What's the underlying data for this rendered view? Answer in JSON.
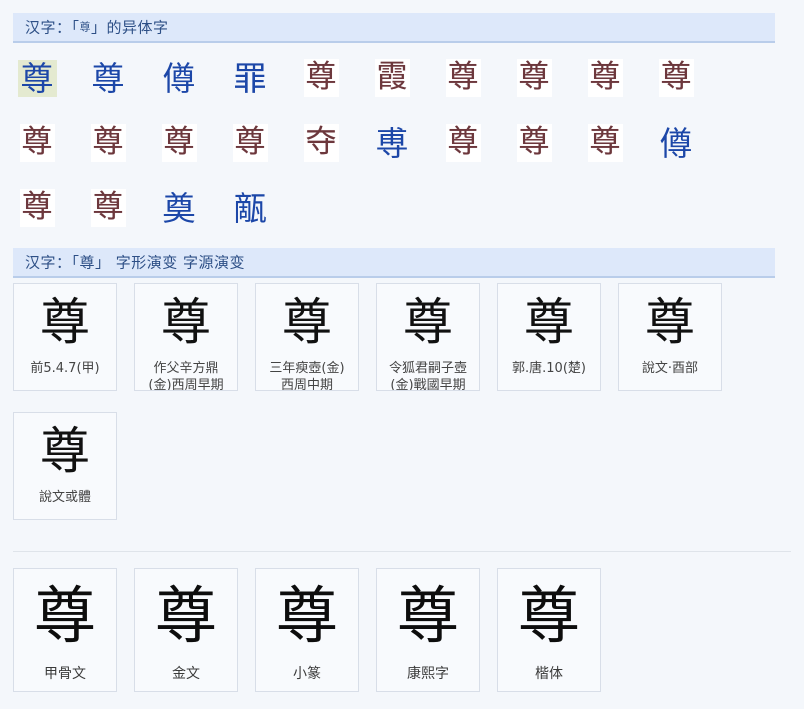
{
  "page": {
    "background_color": "#f4f7fb",
    "band_color": "#dde8fa",
    "band_border_color": "#b9cdea",
    "band_text_color": "#2d4f86",
    "selected_highlight_color": "#e4ead0",
    "variant_text_color": "#1c47a8",
    "variant_scan_color": "#6d3a3f"
  },
  "sections": {
    "variants": {
      "header_prefix": "汉字：「",
      "header_char": "尊",
      "header_suffix": "」的异体字",
      "header_full": "汉字：「尊」的异体字",
      "rows": [
        [
          {
            "glyph": "尊",
            "kind": "text",
            "selected": true
          },
          {
            "glyph": "尊",
            "kind": "text",
            "selected": false
          },
          {
            "glyph": "僔",
            "kind": "text",
            "selected": false
          },
          {
            "glyph": "罪",
            "kind": "text",
            "selected": false
          },
          {
            "glyph": "尊",
            "kind": "scan",
            "selected": false
          },
          {
            "glyph": "霞",
            "kind": "scan",
            "selected": false
          },
          {
            "glyph": "尊",
            "kind": "scan",
            "selected": false
          },
          {
            "glyph": "尊",
            "kind": "scan",
            "selected": false
          },
          {
            "glyph": "尊",
            "kind": "scan",
            "selected": false
          },
          {
            "glyph": "尊",
            "kind": "scan",
            "selected": false
          }
        ],
        [
          {
            "glyph": "尊",
            "kind": "scan",
            "selected": false
          },
          {
            "glyph": "尊",
            "kind": "scan",
            "selected": false
          },
          {
            "glyph": "尊",
            "kind": "scan",
            "selected": false
          },
          {
            "glyph": "尊",
            "kind": "scan",
            "selected": false
          },
          {
            "glyph": "夺",
            "kind": "scan",
            "selected": false
          },
          {
            "glyph": "尃",
            "kind": "text",
            "selected": false
          },
          {
            "glyph": "尊",
            "kind": "scan",
            "selected": false
          },
          {
            "glyph": "尊",
            "kind": "scan",
            "selected": false
          },
          {
            "glyph": "尊",
            "kind": "scan",
            "selected": false
          },
          {
            "glyph": "僔",
            "kind": "text",
            "selected": false
          }
        ],
        [
          {
            "glyph": "尊",
            "kind": "scan",
            "selected": false
          },
          {
            "glyph": "尊",
            "kind": "scan",
            "selected": false
          },
          {
            "glyph": "奠",
            "kind": "text",
            "selected": false
          },
          {
            "glyph": "甋",
            "kind": "text",
            "selected": false
          }
        ]
      ]
    },
    "evolution": {
      "header_prefix": "汉字：「",
      "header_char": "尊",
      "header_suffix": "」 字形演变 字源演变",
      "header_full": "汉字：「尊」 字形演变 字源演变",
      "cards": [
        {
          "glyph": "尊",
          "label": "前5.4.7(甲)",
          "sub": ""
        },
        {
          "glyph": "尊",
          "label": "作父辛方鼎",
          "sub": "(金)西周早期"
        },
        {
          "glyph": "尊",
          "label": "三年瘐壺(金)",
          "sub": "西周中期"
        },
        {
          "glyph": "尊",
          "label": "令狐君嗣子壺",
          "sub": "(金)戰國早期"
        },
        {
          "glyph": "尊",
          "label": "郭.唐.10(楚)",
          "sub": ""
        },
        {
          "glyph": "尊",
          "label": "說文·酉部",
          "sub": ""
        },
        {
          "glyph": "尊",
          "label": "說文或體",
          "sub": ""
        }
      ]
    },
    "scripts": {
      "cards": [
        {
          "glyph": "尊",
          "label": "甲骨文"
        },
        {
          "glyph": "尊",
          "label": "金文"
        },
        {
          "glyph": "尊",
          "label": "小篆"
        },
        {
          "glyph": "尊",
          "label": "康熙字"
        },
        {
          "glyph": "尊",
          "label": "楷体"
        }
      ]
    }
  }
}
